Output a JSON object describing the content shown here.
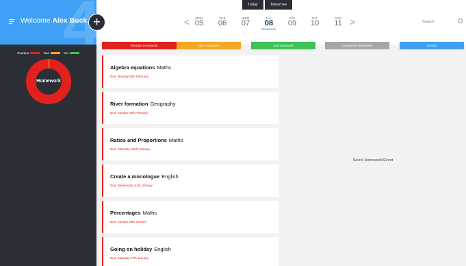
{
  "header": {
    "welcome_prefix": "Welcome",
    "user_name": "Alex Buck",
    "add_label": "+",
    "today_label": "Today",
    "tomorrow_label": "Tomorrow",
    "prev_label": "<",
    "next_label": ">",
    "days": [
      {
        "name": "MON",
        "date": "05"
      },
      {
        "name": "TUE",
        "date": "06"
      },
      {
        "name": "WED",
        "date": "07"
      },
      {
        "name": "THU",
        "date": "08",
        "month": "FEBRUARY",
        "active": true
      },
      {
        "name": "FRI",
        "date": "09"
      },
      {
        "name": "SAT",
        "date": "10"
      },
      {
        "name": "SUN",
        "date": "11"
      }
    ],
    "search_placeholder": "Search"
  },
  "sidebar": {
    "legend": [
      {
        "label": "Overdue",
        "color": "#e2211c"
      },
      {
        "label": "Due",
        "color": "#f5a623"
      },
      {
        "label": "Set",
        "color": "#3cc255"
      }
    ],
    "donut_label": "Homework",
    "donut_values": {
      "overdue": 0.98,
      "due": 0.01,
      "set": 0.01
    }
  },
  "filters": [
    {
      "label": "Overdue Homework",
      "color": "#e2211c"
    },
    {
      "label": "Due Homework",
      "color": "#f5a623"
    },
    {
      "label": "Set Homework",
      "color": "#3cc255"
    },
    {
      "label": "Completed Homework",
      "color": "#a7a7a7"
    },
    {
      "label": "Events",
      "color": "#3fa0f5"
    }
  ],
  "homework": [
    {
      "title": "Algebra equations",
      "subject": "Maths",
      "due": "Due: Monday 05th February"
    },
    {
      "title": "River formation",
      "subject": "Geography",
      "due": "Due: Sunday 04th February"
    },
    {
      "title": "Ratios and Proportions",
      "subject": "Maths",
      "due": "Due: Saturday 03rd February"
    },
    {
      "title": "Create a monologue",
      "subject": "English",
      "due": "Due: Wednesday 31th January"
    },
    {
      "title": "Percentages",
      "subject": "Maths",
      "due": "Due: Sunday 28th January"
    },
    {
      "title": "Going on holiday",
      "subject": "English",
      "due": "Due: Saturday 27th January"
    }
  ],
  "detail": {
    "placeholder": "Select Homework/Event"
  }
}
